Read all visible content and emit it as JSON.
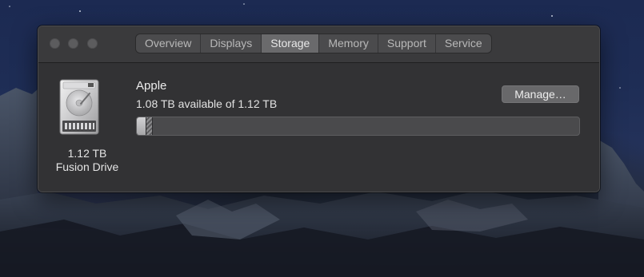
{
  "window": {
    "tabs": [
      {
        "label": "Overview",
        "active": false
      },
      {
        "label": "Displays",
        "active": false
      },
      {
        "label": "Storage",
        "active": true
      },
      {
        "label": "Memory",
        "active": false
      },
      {
        "label": "Support",
        "active": false
      },
      {
        "label": "Service",
        "active": false
      }
    ]
  },
  "drive": {
    "icon": "hard-drive-icon",
    "size": "1.12 TB",
    "type": "Fusion Drive",
    "name": "Apple",
    "available_text": "1.08 TB available of 1.12 TB",
    "used_fraction": 0.036,
    "manage_label": "Manage…"
  },
  "colors": {
    "window_bg": "#323234",
    "titlebar_bg": "#3a3a3c",
    "active_tab": "#6a6a6c"
  }
}
